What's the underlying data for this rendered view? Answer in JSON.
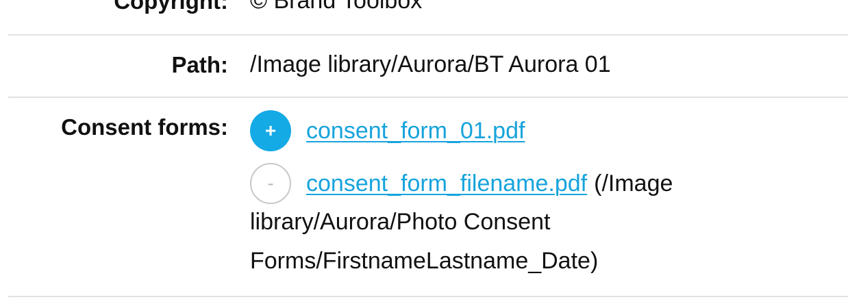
{
  "fields": {
    "copyright": {
      "label": "Copyright:",
      "value": "© Brand Toolbox"
    },
    "path": {
      "label": "Path:",
      "value": "/Image library/Aurora/BT Aurora 01"
    },
    "consent_forms": {
      "label": "Consent forms:",
      "add_button_label": "+",
      "remove_button_label": "-",
      "items": [
        {
          "filename": "consent_form_01.pdf"
        },
        {
          "filename": "consent_form_filename.pdf",
          "location_lines": [
            "(/Image",
            "library/Aurora/Photo Consent",
            "Forms/FirstnameLastname_Date)"
          ]
        }
      ]
    }
  },
  "colors": {
    "accent": "#13aae5",
    "link": "#16a3dc",
    "divider": "#e1e1e1",
    "remove_border": "#c8c8c8"
  }
}
